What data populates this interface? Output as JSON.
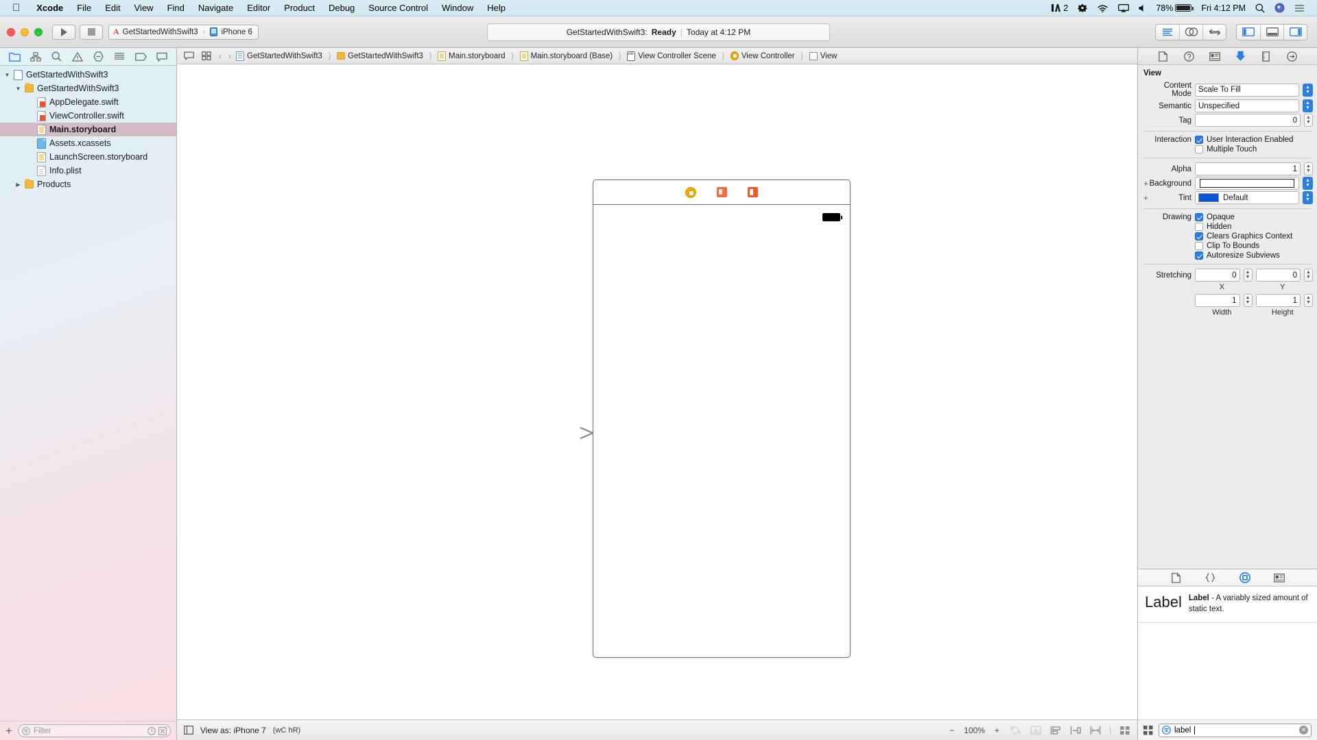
{
  "menubar": {
    "apple_icon": "apple-logo-icon",
    "items": [
      {
        "label": "Xcode",
        "bold": true
      },
      {
        "label": "File",
        "bold": false
      },
      {
        "label": "Edit",
        "bold": false
      },
      {
        "label": "View",
        "bold": false
      },
      {
        "label": "Find",
        "bold": false
      },
      {
        "label": "Navigate",
        "bold": false
      },
      {
        "label": "Editor",
        "bold": false
      },
      {
        "label": "Product",
        "bold": false
      },
      {
        "label": "Debug",
        "bold": false
      },
      {
        "label": "Source Control",
        "bold": false
      },
      {
        "label": "Window",
        "bold": false
      },
      {
        "label": "Help",
        "bold": false
      }
    ],
    "status": {
      "app_badge_count": "2",
      "battery_percent": "78%",
      "clock": "Fri 4:12 PM"
    }
  },
  "toolbar": {
    "run_tooltip": "Run",
    "stop_tooltip": "Stop",
    "scheme_name": "GetStartedWithSwift3",
    "scheme_destination": "iPhone 6",
    "status": {
      "project": "GetStartedWithSwift3:",
      "state": "Ready",
      "separator": "|",
      "time": "Today at 4:12 PM"
    }
  },
  "navigator": {
    "tabs": [
      "project-navigator-icon",
      "source-control-navigator-icon",
      "find-navigator-icon",
      "issue-navigator-icon",
      "test-navigator-icon",
      "debug-navigator-icon",
      "breakpoint-navigator-icon",
      "report-navigator-icon"
    ],
    "tree": [
      {
        "label": "GetStartedWithSwift3",
        "depth": 0,
        "icon": "project-icon",
        "twisty": "down",
        "selected": false
      },
      {
        "label": "GetStartedWithSwift3",
        "depth": 1,
        "icon": "folder-icon",
        "twisty": "down",
        "selected": false
      },
      {
        "label": "AppDelegate.swift",
        "depth": 2,
        "icon": "swift-file-icon",
        "twisty": "",
        "selected": false
      },
      {
        "label": "ViewController.swift",
        "depth": 2,
        "icon": "swift-file-icon",
        "twisty": "",
        "selected": false
      },
      {
        "label": "Main.storyboard",
        "depth": 2,
        "icon": "storyboard-icon",
        "twisty": "",
        "selected": true
      },
      {
        "label": "Assets.xcassets",
        "depth": 2,
        "icon": "assets-icon",
        "twisty": "",
        "selected": false
      },
      {
        "label": "LaunchScreen.storyboard",
        "depth": 2,
        "icon": "storyboard-icon",
        "twisty": "",
        "selected": false
      },
      {
        "label": "Info.plist",
        "depth": 2,
        "icon": "plist-icon",
        "twisty": "",
        "selected": false
      },
      {
        "label": "Products",
        "depth": 1,
        "icon": "folder-icon",
        "twisty": "right",
        "selected": false
      }
    ],
    "filter_placeholder": "Filter",
    "add_button": "+"
  },
  "jumpbar": {
    "back": "‹",
    "forward": "›",
    "crumbs": [
      {
        "label": "GetStartedWithSwift3",
        "icon": "project-icon"
      },
      {
        "label": "GetStartedWithSwift3",
        "icon": "folder-icon"
      },
      {
        "label": "Main.storyboard",
        "icon": "storyboard-icon"
      },
      {
        "label": "Main.storyboard (Base)",
        "icon": "storyboard-icon"
      },
      {
        "label": "View Controller Scene",
        "icon": "scene-icon"
      },
      {
        "label": "View Controller",
        "icon": "view-controller-icon"
      },
      {
        "label": "View",
        "icon": "view-icon"
      }
    ]
  },
  "canvas": {
    "scene_dock_icons": [
      "view-controller-icon",
      "first-responder-icon",
      "exit-icon"
    ],
    "entry_arrow": "storyboard-entry-point-arrow"
  },
  "canvas_bottom": {
    "view_as_label": "View as: iPhone 7",
    "size_classes": "(wC hR)",
    "zoom_out": "−",
    "zoom_level": "100%",
    "zoom_in": "+",
    "tool_icons": [
      "update-frames-icon",
      "embed-in-icon",
      "align-icon",
      "pin-icon",
      "resolve-auto-layout-icon",
      "document-outline-icon"
    ]
  },
  "inspector": {
    "tabs": [
      "file-inspector-icon",
      "quick-help-inspector-icon",
      "identity-inspector-icon",
      "attributes-inspector-icon",
      "size-inspector-icon",
      "connections-inspector-icon"
    ],
    "active_tab": "attributes-inspector-icon",
    "section_title": "View",
    "fields": [
      {
        "label": "Content Mode",
        "value": "Scale To Fill",
        "type": "popup"
      },
      {
        "label": "Semantic",
        "value": "Unspecified",
        "type": "popup"
      },
      {
        "label": "Tag",
        "value": "0",
        "type": "stepper-number"
      }
    ],
    "interaction": {
      "label": "Interaction",
      "options": [
        {
          "label": "User Interaction Enabled",
          "checked": true
        },
        {
          "label": "Multiple Touch",
          "checked": false
        }
      ]
    },
    "alpha": {
      "label": "Alpha",
      "value": "1"
    },
    "background": {
      "label": "Background",
      "value": "",
      "color": "#ffffff"
    },
    "tint": {
      "label": "Tint",
      "value": "Default",
      "color": "#0b55d8"
    },
    "drawing": {
      "label": "Drawing",
      "options": [
        {
          "label": "Opaque",
          "checked": true
        },
        {
          "label": "Hidden",
          "checked": false
        },
        {
          "label": "Clears Graphics Context",
          "checked": true
        },
        {
          "label": "Clip To Bounds",
          "checked": false
        },
        {
          "label": "Autoresize Subviews",
          "checked": true
        }
      ]
    },
    "stretching": {
      "label": "Stretching",
      "x": {
        "value": "0",
        "caption": "X"
      },
      "y": {
        "value": "0",
        "caption": "Y"
      },
      "width": {
        "value": "1",
        "caption": "Width"
      },
      "height": {
        "value": "1",
        "caption": "Height"
      }
    }
  },
  "library": {
    "tabs": [
      "file-template-library-icon",
      "code-snippet-library-icon",
      "object-library-icon",
      "media-library-icon"
    ],
    "active_tab": "object-library-icon",
    "items": [
      {
        "preview_text": "Label",
        "title": "Label",
        "dash": " - ",
        "description": "A variably sized amount of static text."
      }
    ],
    "search_value": "label",
    "search_icon": "filter-icon",
    "clear_icon": "clear-icon",
    "layout_toggle": "grid-view-icon"
  }
}
